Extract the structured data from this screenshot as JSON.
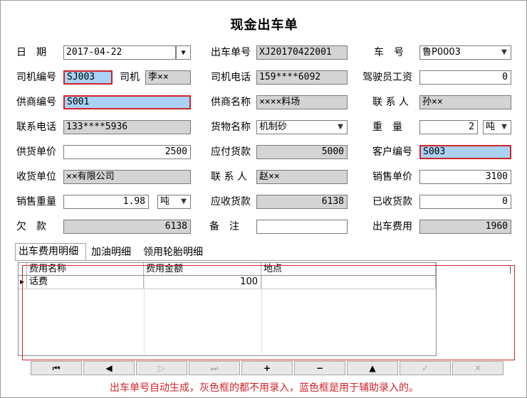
{
  "title": "现金出车单",
  "labels": {
    "date": "日　期",
    "order_no": "出车单号",
    "vehicle_no": "车　号",
    "driver_id": "司机编号",
    "driver": "司机",
    "driver_phone": "司机电话",
    "driver_wage": "驾驶员工资",
    "supplier_id": "供商编号",
    "supplier_name": "供商名称",
    "supplier_contact": "联 系 人",
    "contact_phone": "联系电话",
    "goods_name": "货物名称",
    "weight": "重　量",
    "supply_price": "供货单价",
    "payable": "应付货款",
    "customer_id": "客户编号",
    "receiver": "收货单位",
    "receiver_contact": "联 系 人",
    "sale_price": "销售单价",
    "sale_weight": "销售重量",
    "receivable": "应收货款",
    "received": "已收货款",
    "debt": "欠　款",
    "remark": "备　注",
    "trip_cost": "出车费用"
  },
  "values": {
    "date": "2017-04-22",
    "order_no": "XJ20170422001",
    "vehicle_no": "鲁P0003",
    "driver_id": "SJ003",
    "driver": "李××",
    "driver_phone": "159****6092",
    "driver_wage": "0",
    "supplier_id": "S001",
    "supplier_name": "××××料场",
    "supplier_contact": "孙××",
    "contact_phone": "133****5936",
    "goods_name": "机制砂",
    "weight": "2",
    "weight_unit": "吨",
    "supply_price": "2500",
    "payable": "5000",
    "customer_id": "S003",
    "receiver": "××有限公司",
    "receiver_contact": "赵××",
    "sale_price": "3100",
    "sale_weight": "1.98",
    "sale_weight_unit": "吨",
    "receivable": "6138",
    "received": "0",
    "debt": "6138",
    "remark": "",
    "trip_cost": "1960"
  },
  "tabs": [
    "出车费用明细",
    "加油明细",
    "领用轮胎明细"
  ],
  "grid": {
    "columns": [
      "费用名称",
      "费用金额",
      "地点"
    ],
    "rows": [
      {
        "name": "话费",
        "amount": "100",
        "place": ""
      }
    ]
  },
  "nav_buttons": [
    {
      "icon": "first-record-icon",
      "glyph": "⏮"
    },
    {
      "icon": "prev-record-icon",
      "glyph": "◀"
    },
    {
      "icon": "next-record-icon",
      "glyph": "▷"
    },
    {
      "icon": "last-record-icon",
      "glyph": "⏭"
    },
    {
      "icon": "add-record-icon",
      "glyph": "+"
    },
    {
      "icon": "delete-record-icon",
      "glyph": "−"
    },
    {
      "icon": "edit-record-icon",
      "glyph": "▲"
    },
    {
      "icon": "post-record-icon",
      "glyph": "✓"
    },
    {
      "icon": "cancel-record-icon",
      "glyph": "✕"
    }
  ],
  "note": "出车单号自动生成，灰色框的都不用录入，蓝色框是用于辅助录入的。",
  "colors": {
    "highlight_border": "#d2232a",
    "lookup_fill": "#a9d2f5",
    "readonly_fill": "#d4d4d4"
  }
}
